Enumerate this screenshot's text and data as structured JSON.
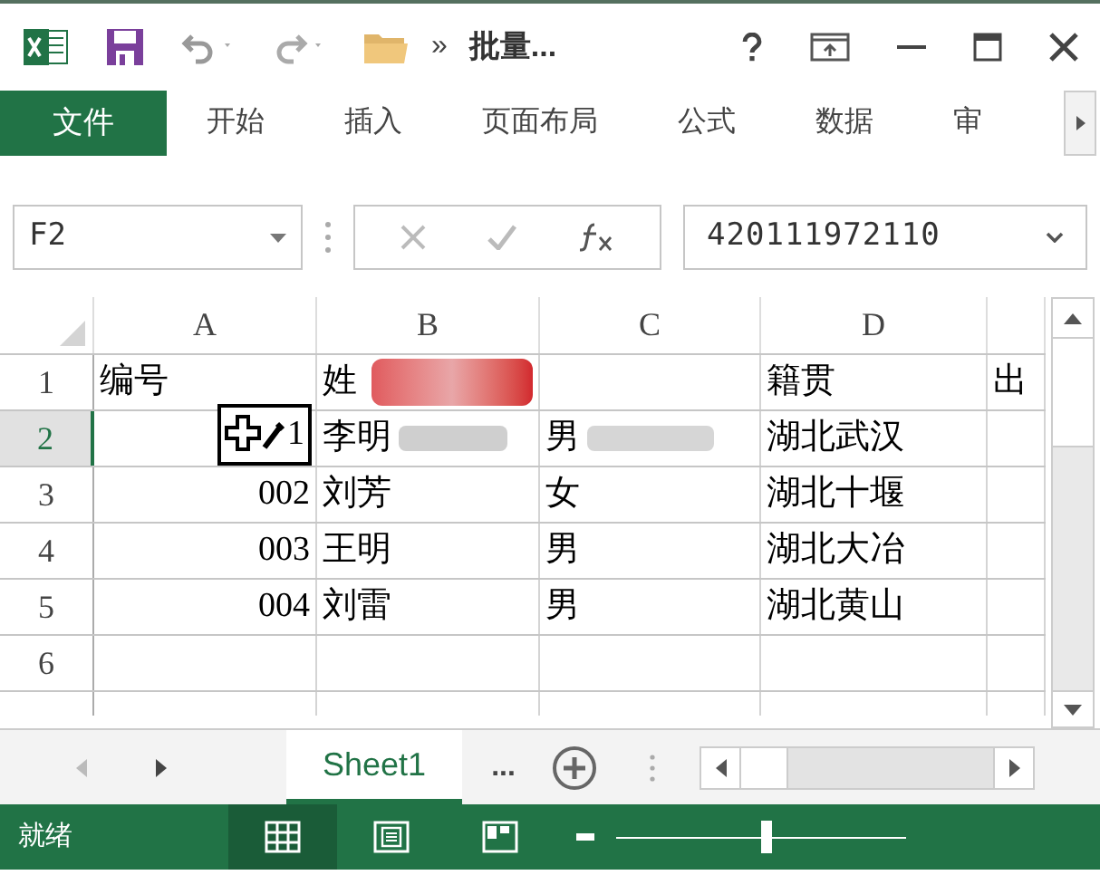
{
  "title_bar": {
    "title": "批量...",
    "more": "»"
  },
  "ribbon_tabs": [
    {
      "label": "文件",
      "kind": "file"
    },
    {
      "label": "开始",
      "kind": "tab"
    },
    {
      "label": "插入",
      "kind": "tab"
    },
    {
      "label": "页面布局",
      "kind": "tab"
    },
    {
      "label": "公式",
      "kind": "tab"
    },
    {
      "label": "数据",
      "kind": "tab"
    },
    {
      "label": "审",
      "kind": "tab"
    }
  ],
  "name_box": {
    "value": "F2"
  },
  "formula_bar": {
    "value": "420111972110"
  },
  "columns": [
    {
      "label": "A"
    },
    {
      "label": "B"
    },
    {
      "label": "C"
    },
    {
      "label": "D"
    }
  ],
  "rows": [
    {
      "header": "1",
      "selected": false,
      "cells": [
        "编号",
        "姓",
        "",
        "籍贯",
        "出"
      ]
    },
    {
      "header": "2",
      "selected": true,
      "cells": [
        "1",
        "李明",
        "男",
        "湖北武汉",
        ""
      ]
    },
    {
      "header": "3",
      "selected": false,
      "cells": [
        "002",
        "刘芳",
        "女",
        "湖北十堰",
        ""
      ]
    },
    {
      "header": "4",
      "selected": false,
      "cells": [
        "003",
        "王明",
        "男",
        "湖北大冶",
        ""
      ]
    },
    {
      "header": "5",
      "selected": false,
      "cells": [
        "004",
        "刘雷",
        "男",
        "湖北黄山",
        ""
      ]
    },
    {
      "header": "6",
      "selected": false,
      "cells": [
        "",
        "",
        "",
        "",
        ""
      ]
    },
    {
      "selected": false,
      "cells": [
        "",
        "",
        "",
        "",
        ""
      ]
    }
  ],
  "sheet_tabs": [
    {
      "label": "Sheet1",
      "selected": true
    }
  ],
  "sheet_more": "...",
  "status_bar": {
    "text": "就绪"
  },
  "view_buttons": [
    {
      "kind": "normal",
      "selected": true
    },
    {
      "kind": "page_layout",
      "selected": false
    },
    {
      "kind": "page_break",
      "selected": false
    }
  ],
  "zoom": {
    "level": 0.52
  }
}
